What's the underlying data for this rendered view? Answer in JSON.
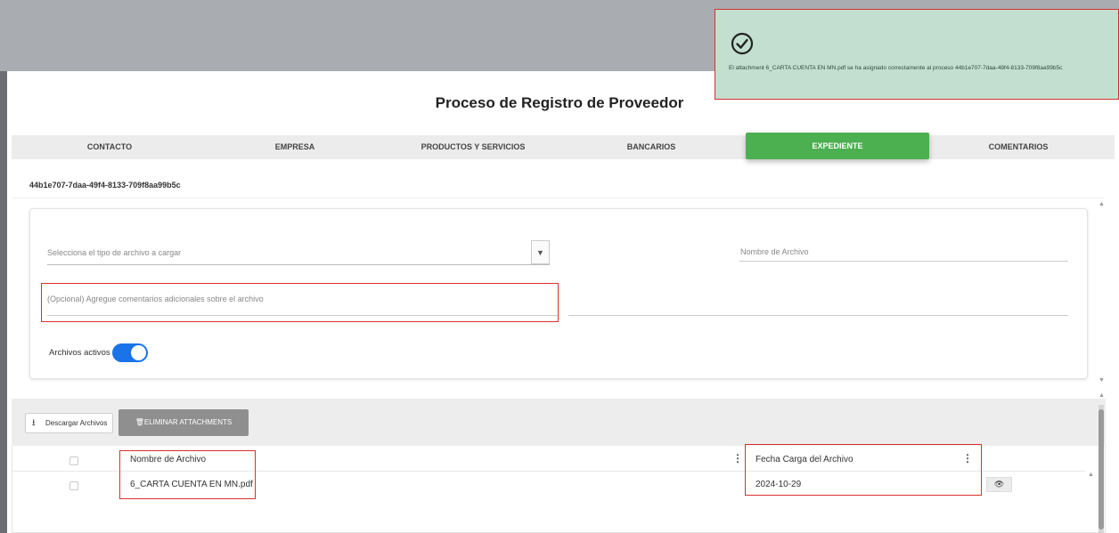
{
  "page": {
    "title": "Proceso de Registro de Proveedor"
  },
  "tabs": [
    {
      "label": "CONTACTO"
    },
    {
      "label": "EMPRESA"
    },
    {
      "label": "PRODUCTOS Y SERVICIOS"
    },
    {
      "label": "BANCARIOS"
    },
    {
      "label": "EXPEDIENTE"
    },
    {
      "label": "COMENTARIOS"
    }
  ],
  "active_tab": "EXPEDIENTE",
  "process_id": "44b1e707-7daa-49f4-8133-709f8aa99b5c",
  "form": {
    "file_type_placeholder": "Selecciona el tipo de archivo a cargar",
    "file_name_placeholder": "Nombre de Archivo",
    "comments_placeholder": "(Opcional) Agregue comentarios adicionales sobre el archivo",
    "active_files_label": "Archivos activos",
    "active_files_on": true
  },
  "toolbar": {
    "download_label": "Descargar Archivos",
    "delete_label": "ELIMINAR ATTACHMENTS"
  },
  "table": {
    "columns": [
      "Nombre de Archivo",
      "Fecha Carga del Archivo"
    ],
    "rows": [
      {
        "file_name": "6_CARTA CUENTA EN MN.pdf",
        "upload_date": "2024-10-29"
      }
    ]
  },
  "toast": {
    "message": "El attachment 6_CARTA CUENTA EN MN.pdf se ha asignado correctamente al proceso 44b1e707-7daa-49f4-8133-709f8aa99b5c"
  },
  "colors": {
    "accent": "#4caf50",
    "toggle": "#1a73e8",
    "highlight": "#d9302f",
    "toast_bg": "#c2dfcf"
  }
}
